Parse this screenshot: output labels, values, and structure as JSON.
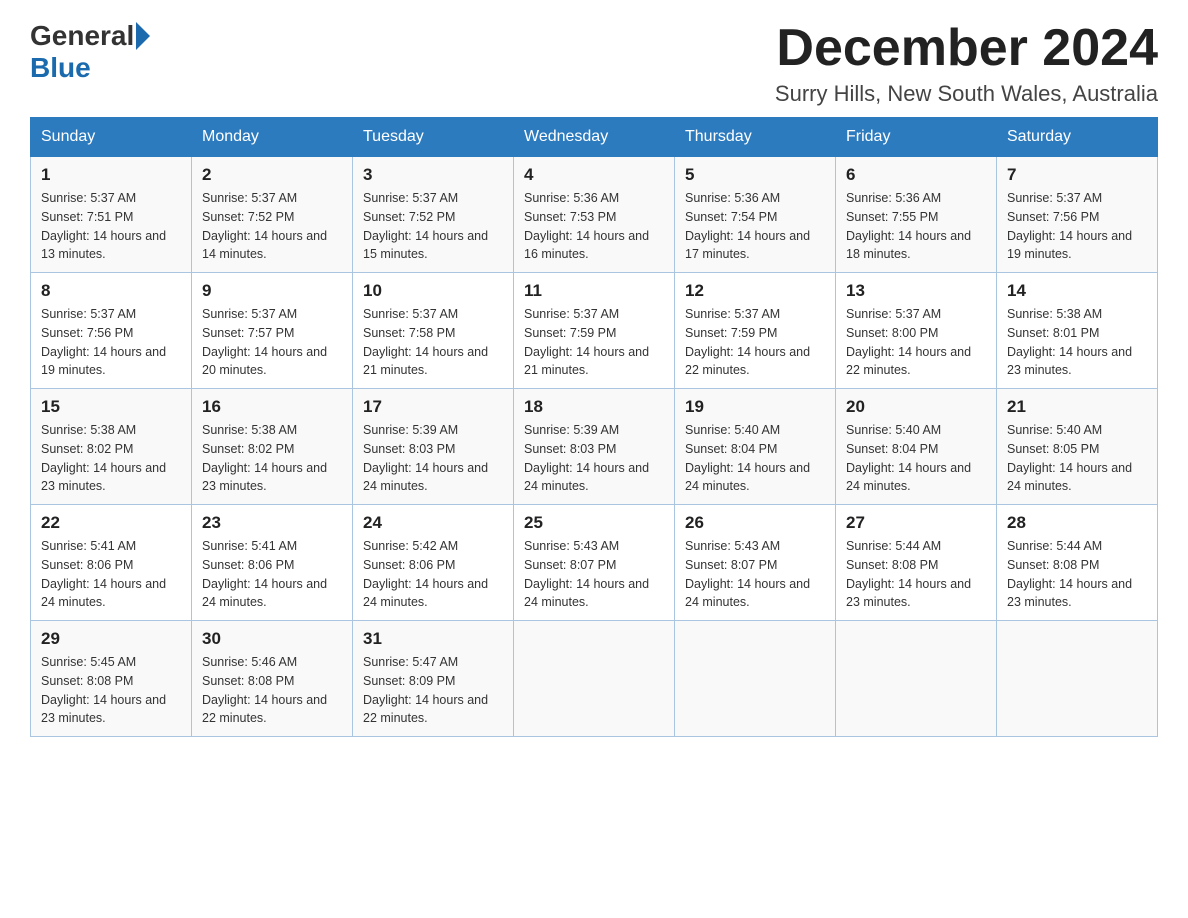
{
  "header": {
    "logo_general": "General",
    "logo_blue": "Blue",
    "month_title": "December 2024",
    "subtitle": "Surry Hills, New South Wales, Australia"
  },
  "weekdays": [
    "Sunday",
    "Monday",
    "Tuesday",
    "Wednesday",
    "Thursday",
    "Friday",
    "Saturday"
  ],
  "weeks": [
    [
      {
        "day": "1",
        "sunrise": "5:37 AM",
        "sunset": "7:51 PM",
        "daylight": "14 hours and 13 minutes."
      },
      {
        "day": "2",
        "sunrise": "5:37 AM",
        "sunset": "7:52 PM",
        "daylight": "14 hours and 14 minutes."
      },
      {
        "day": "3",
        "sunrise": "5:37 AM",
        "sunset": "7:52 PM",
        "daylight": "14 hours and 15 minutes."
      },
      {
        "day": "4",
        "sunrise": "5:36 AM",
        "sunset": "7:53 PM",
        "daylight": "14 hours and 16 minutes."
      },
      {
        "day": "5",
        "sunrise": "5:36 AM",
        "sunset": "7:54 PM",
        "daylight": "14 hours and 17 minutes."
      },
      {
        "day": "6",
        "sunrise": "5:36 AM",
        "sunset": "7:55 PM",
        "daylight": "14 hours and 18 minutes."
      },
      {
        "day": "7",
        "sunrise": "5:37 AM",
        "sunset": "7:56 PM",
        "daylight": "14 hours and 19 minutes."
      }
    ],
    [
      {
        "day": "8",
        "sunrise": "5:37 AM",
        "sunset": "7:56 PM",
        "daylight": "14 hours and 19 minutes."
      },
      {
        "day": "9",
        "sunrise": "5:37 AM",
        "sunset": "7:57 PM",
        "daylight": "14 hours and 20 minutes."
      },
      {
        "day": "10",
        "sunrise": "5:37 AM",
        "sunset": "7:58 PM",
        "daylight": "14 hours and 21 minutes."
      },
      {
        "day": "11",
        "sunrise": "5:37 AM",
        "sunset": "7:59 PM",
        "daylight": "14 hours and 21 minutes."
      },
      {
        "day": "12",
        "sunrise": "5:37 AM",
        "sunset": "7:59 PM",
        "daylight": "14 hours and 22 minutes."
      },
      {
        "day": "13",
        "sunrise": "5:37 AM",
        "sunset": "8:00 PM",
        "daylight": "14 hours and 22 minutes."
      },
      {
        "day": "14",
        "sunrise": "5:38 AM",
        "sunset": "8:01 PM",
        "daylight": "14 hours and 23 minutes."
      }
    ],
    [
      {
        "day": "15",
        "sunrise": "5:38 AM",
        "sunset": "8:02 PM",
        "daylight": "14 hours and 23 minutes."
      },
      {
        "day": "16",
        "sunrise": "5:38 AM",
        "sunset": "8:02 PM",
        "daylight": "14 hours and 23 minutes."
      },
      {
        "day": "17",
        "sunrise": "5:39 AM",
        "sunset": "8:03 PM",
        "daylight": "14 hours and 24 minutes."
      },
      {
        "day": "18",
        "sunrise": "5:39 AM",
        "sunset": "8:03 PM",
        "daylight": "14 hours and 24 minutes."
      },
      {
        "day": "19",
        "sunrise": "5:40 AM",
        "sunset": "8:04 PM",
        "daylight": "14 hours and 24 minutes."
      },
      {
        "day": "20",
        "sunrise": "5:40 AM",
        "sunset": "8:04 PM",
        "daylight": "14 hours and 24 minutes."
      },
      {
        "day": "21",
        "sunrise": "5:40 AM",
        "sunset": "8:05 PM",
        "daylight": "14 hours and 24 minutes."
      }
    ],
    [
      {
        "day": "22",
        "sunrise": "5:41 AM",
        "sunset": "8:06 PM",
        "daylight": "14 hours and 24 minutes."
      },
      {
        "day": "23",
        "sunrise": "5:41 AM",
        "sunset": "8:06 PM",
        "daylight": "14 hours and 24 minutes."
      },
      {
        "day": "24",
        "sunrise": "5:42 AM",
        "sunset": "8:06 PM",
        "daylight": "14 hours and 24 minutes."
      },
      {
        "day": "25",
        "sunrise": "5:43 AM",
        "sunset": "8:07 PM",
        "daylight": "14 hours and 24 minutes."
      },
      {
        "day": "26",
        "sunrise": "5:43 AM",
        "sunset": "8:07 PM",
        "daylight": "14 hours and 24 minutes."
      },
      {
        "day": "27",
        "sunrise": "5:44 AM",
        "sunset": "8:08 PM",
        "daylight": "14 hours and 23 minutes."
      },
      {
        "day": "28",
        "sunrise": "5:44 AM",
        "sunset": "8:08 PM",
        "daylight": "14 hours and 23 minutes."
      }
    ],
    [
      {
        "day": "29",
        "sunrise": "5:45 AM",
        "sunset": "8:08 PM",
        "daylight": "14 hours and 23 minutes."
      },
      {
        "day": "30",
        "sunrise": "5:46 AM",
        "sunset": "8:08 PM",
        "daylight": "14 hours and 22 minutes."
      },
      {
        "day": "31",
        "sunrise": "5:47 AM",
        "sunset": "8:09 PM",
        "daylight": "14 hours and 22 minutes."
      },
      null,
      null,
      null,
      null
    ]
  ]
}
